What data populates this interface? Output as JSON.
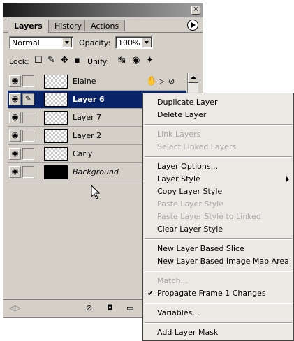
{
  "palette": {
    "tabs": [
      "Layers",
      "History",
      "Actions"
    ],
    "blend_mode": "Normal",
    "opacity_label": "Opacity:",
    "opacity_value": "100%",
    "lock_label": "Lock:",
    "unify_label": "Unify:"
  },
  "layers": [
    {
      "name": "Elaine",
      "selected": false,
      "style": "normal"
    },
    {
      "name": "Layer 6",
      "selected": true,
      "style": "bold"
    },
    {
      "name": "Layer 7",
      "selected": false,
      "style": "normal"
    },
    {
      "name": "Layer 2",
      "selected": false,
      "style": "normal"
    },
    {
      "name": "Carly",
      "selected": false,
      "style": "normal"
    },
    {
      "name": "Background",
      "selected": false,
      "style": "italic"
    }
  ],
  "context_menu": {
    "groups": [
      [
        {
          "label": "Duplicate Layer",
          "enabled": true
        },
        {
          "label": "Delete Layer",
          "enabled": true
        }
      ],
      [
        {
          "label": "Link Layers",
          "enabled": false
        },
        {
          "label": "Select Linked Layers",
          "enabled": false
        }
      ],
      [
        {
          "label": "Layer Options...",
          "enabled": true
        },
        {
          "label": "Layer Style",
          "enabled": true,
          "submenu": true
        },
        {
          "label": "Copy Layer Style",
          "enabled": true
        },
        {
          "label": "Paste Layer Style",
          "enabled": false
        },
        {
          "label": "Paste Layer Style to Linked",
          "enabled": false
        },
        {
          "label": "Clear Layer Style",
          "enabled": true
        }
      ],
      [
        {
          "label": "New Layer Based Slice",
          "enabled": true
        },
        {
          "label": "New Layer Based Image Map Area",
          "enabled": true
        }
      ],
      [
        {
          "label": "Match...",
          "enabled": false
        },
        {
          "label": "Propagate Frame 1 Changes",
          "enabled": true,
          "checked": true
        }
      ],
      [
        {
          "label": "Variables...",
          "enabled": true
        }
      ],
      [
        {
          "label": "Add Layer Mask",
          "enabled": true
        }
      ]
    ]
  }
}
